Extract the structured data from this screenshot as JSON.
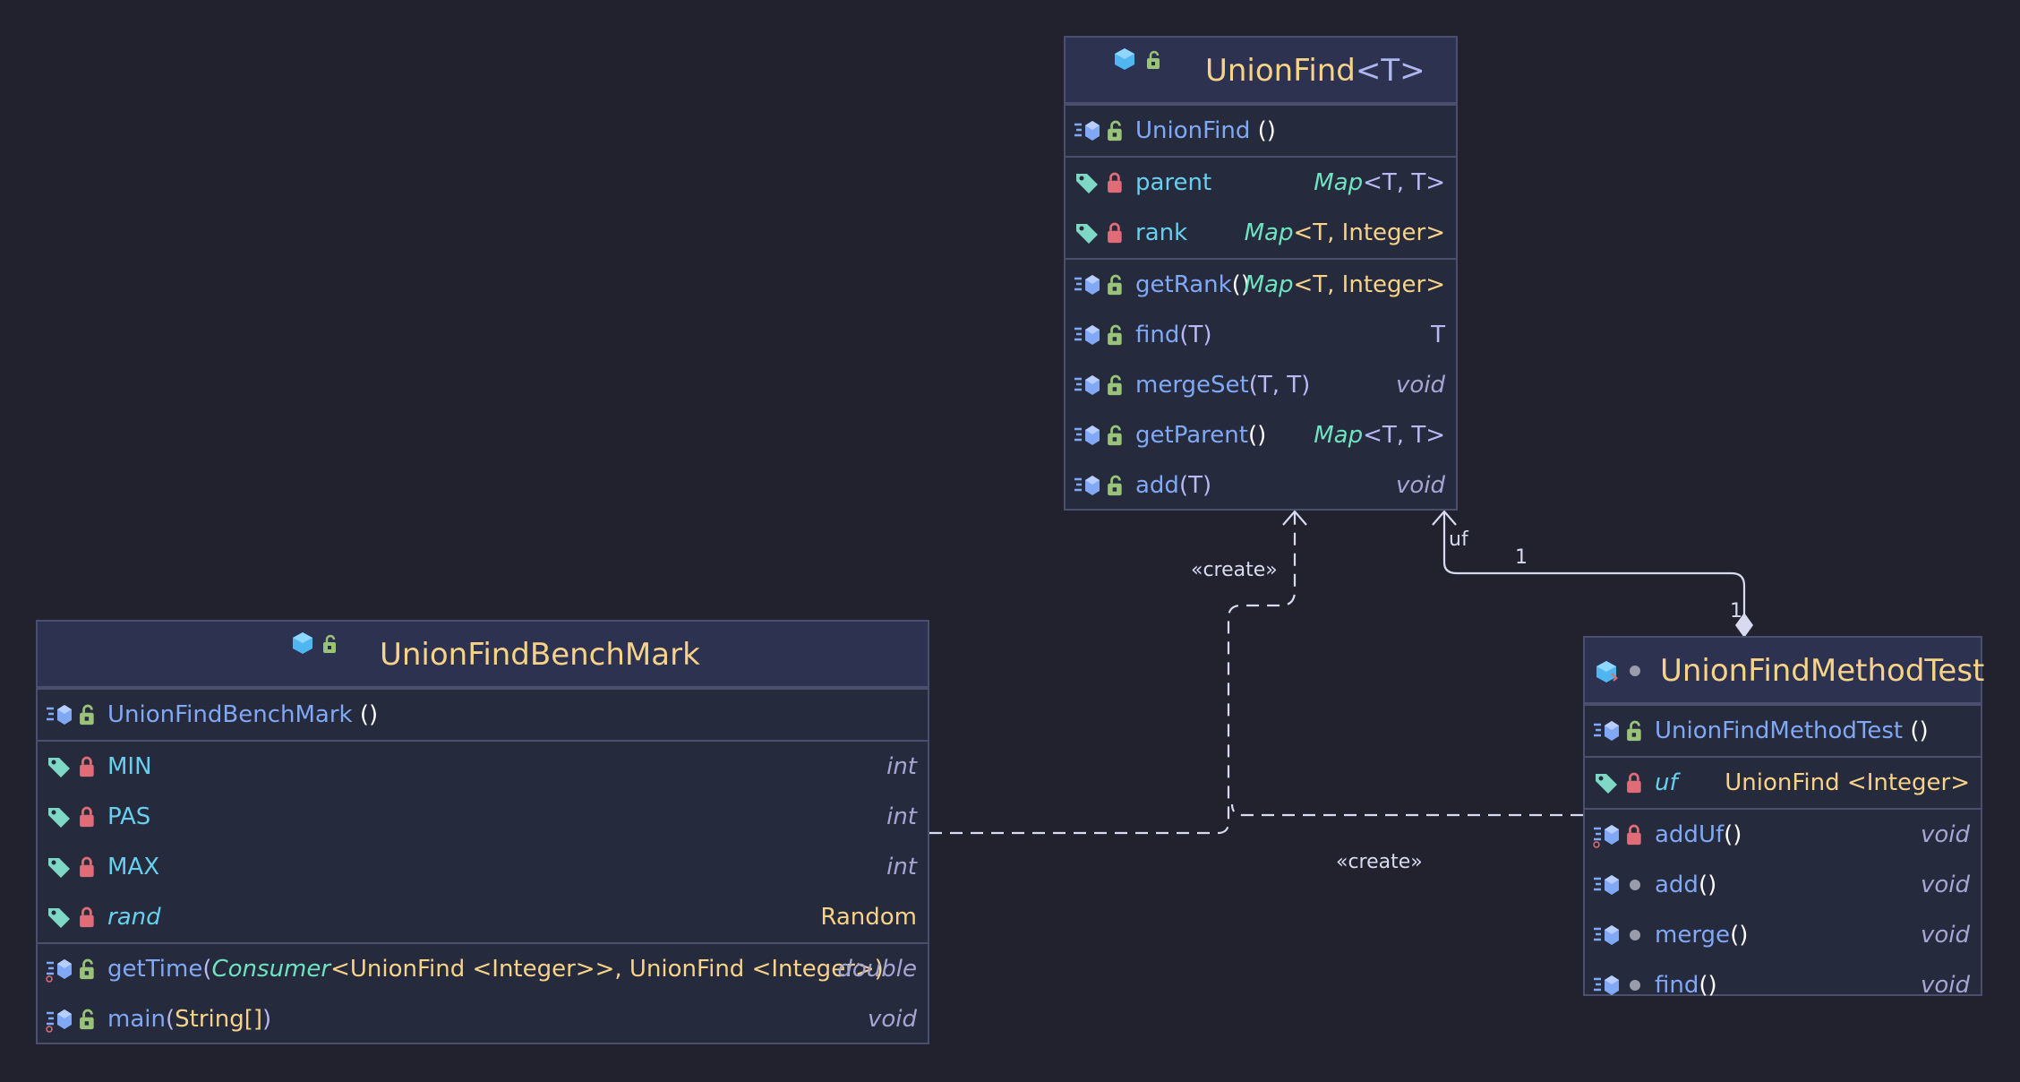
{
  "classes": {
    "union_find": {
      "title": "UnionFind",
      "type_param": "<T>",
      "constructor": {
        "name": "UnionFind",
        "params": "()"
      },
      "fields": [
        {
          "name": "parent",
          "type_main": "Map",
          "type_rest": "<T, T>"
        },
        {
          "name": "rank",
          "type_main": "Map",
          "type_rest": "<T, Integer>"
        }
      ],
      "methods": [
        {
          "name": "getRank",
          "params": "()",
          "type_main": "Map",
          "type_rest": "<T, Integer>"
        },
        {
          "name": "find",
          "params": "(T)",
          "type": "T"
        },
        {
          "name": "mergeSet",
          "params": "(T, T)",
          "type": "void"
        },
        {
          "name": "getParent",
          "params": "()",
          "type_main": "Map",
          "type_rest": "<T, T>"
        },
        {
          "name": "add",
          "params": "(T)",
          "type": "void"
        }
      ]
    },
    "bench_mark": {
      "title": "UnionFindBenchMark",
      "constructor": {
        "name": "UnionFindBenchMark",
        "params": "()"
      },
      "fields": [
        {
          "name": "MIN",
          "type": "int"
        },
        {
          "name": "PAS",
          "type": "int"
        },
        {
          "name": "MAX",
          "type": "int"
        },
        {
          "name": "rand",
          "type": "Random"
        }
      ],
      "methods": [
        {
          "name": "getTime",
          "params_parts": [
            "(",
            "Consumer",
            "<UnionFind <Integer>>, UnionFind <Integer>)"
          ],
          "type": "double"
        },
        {
          "name": "main",
          "params_parts": [
            "(",
            "String[]",
            ")"
          ],
          "type": "void"
        }
      ]
    },
    "method_test": {
      "title": "UnionFindMethodTest",
      "constructor": {
        "name": "UnionFindMethodTest",
        "params": "()"
      },
      "fields": [
        {
          "name": "uf",
          "type": "UnionFind <Integer>"
        }
      ],
      "methods": [
        {
          "name": "addUf",
          "params": "()",
          "type": "void"
        },
        {
          "name": "add",
          "params": "()",
          "type": "void"
        },
        {
          "name": "merge",
          "params": "()",
          "type": "void"
        },
        {
          "name": "find",
          "params": "()",
          "type": "void"
        }
      ]
    }
  },
  "relations": {
    "create_label_1": "«create»",
    "create_label_2": "«create»",
    "assoc_role": "uf",
    "assoc_mult_target": "1",
    "assoc_mult_source": "1"
  },
  "colors": {
    "background": "#22222f",
    "class_header": "#2d3250",
    "class_body": "#262a3d",
    "border": "#4b4f6e",
    "class_title": "#f7d38a",
    "method_name": "#80a8f5",
    "field_name": "#68d0ee",
    "generic_type": "#6fe3c0",
    "lock_private": "#e06c78",
    "lock_public": "#98c379",
    "connector": "#d8dbf0"
  },
  "icons": [
    "class-icon",
    "method-icon",
    "field-tag-icon",
    "lock-private-icon",
    "lock-public-icon",
    "package-dot-icon",
    "static-method-icon",
    "diamond-composition-icon",
    "open-arrow-icon"
  ]
}
